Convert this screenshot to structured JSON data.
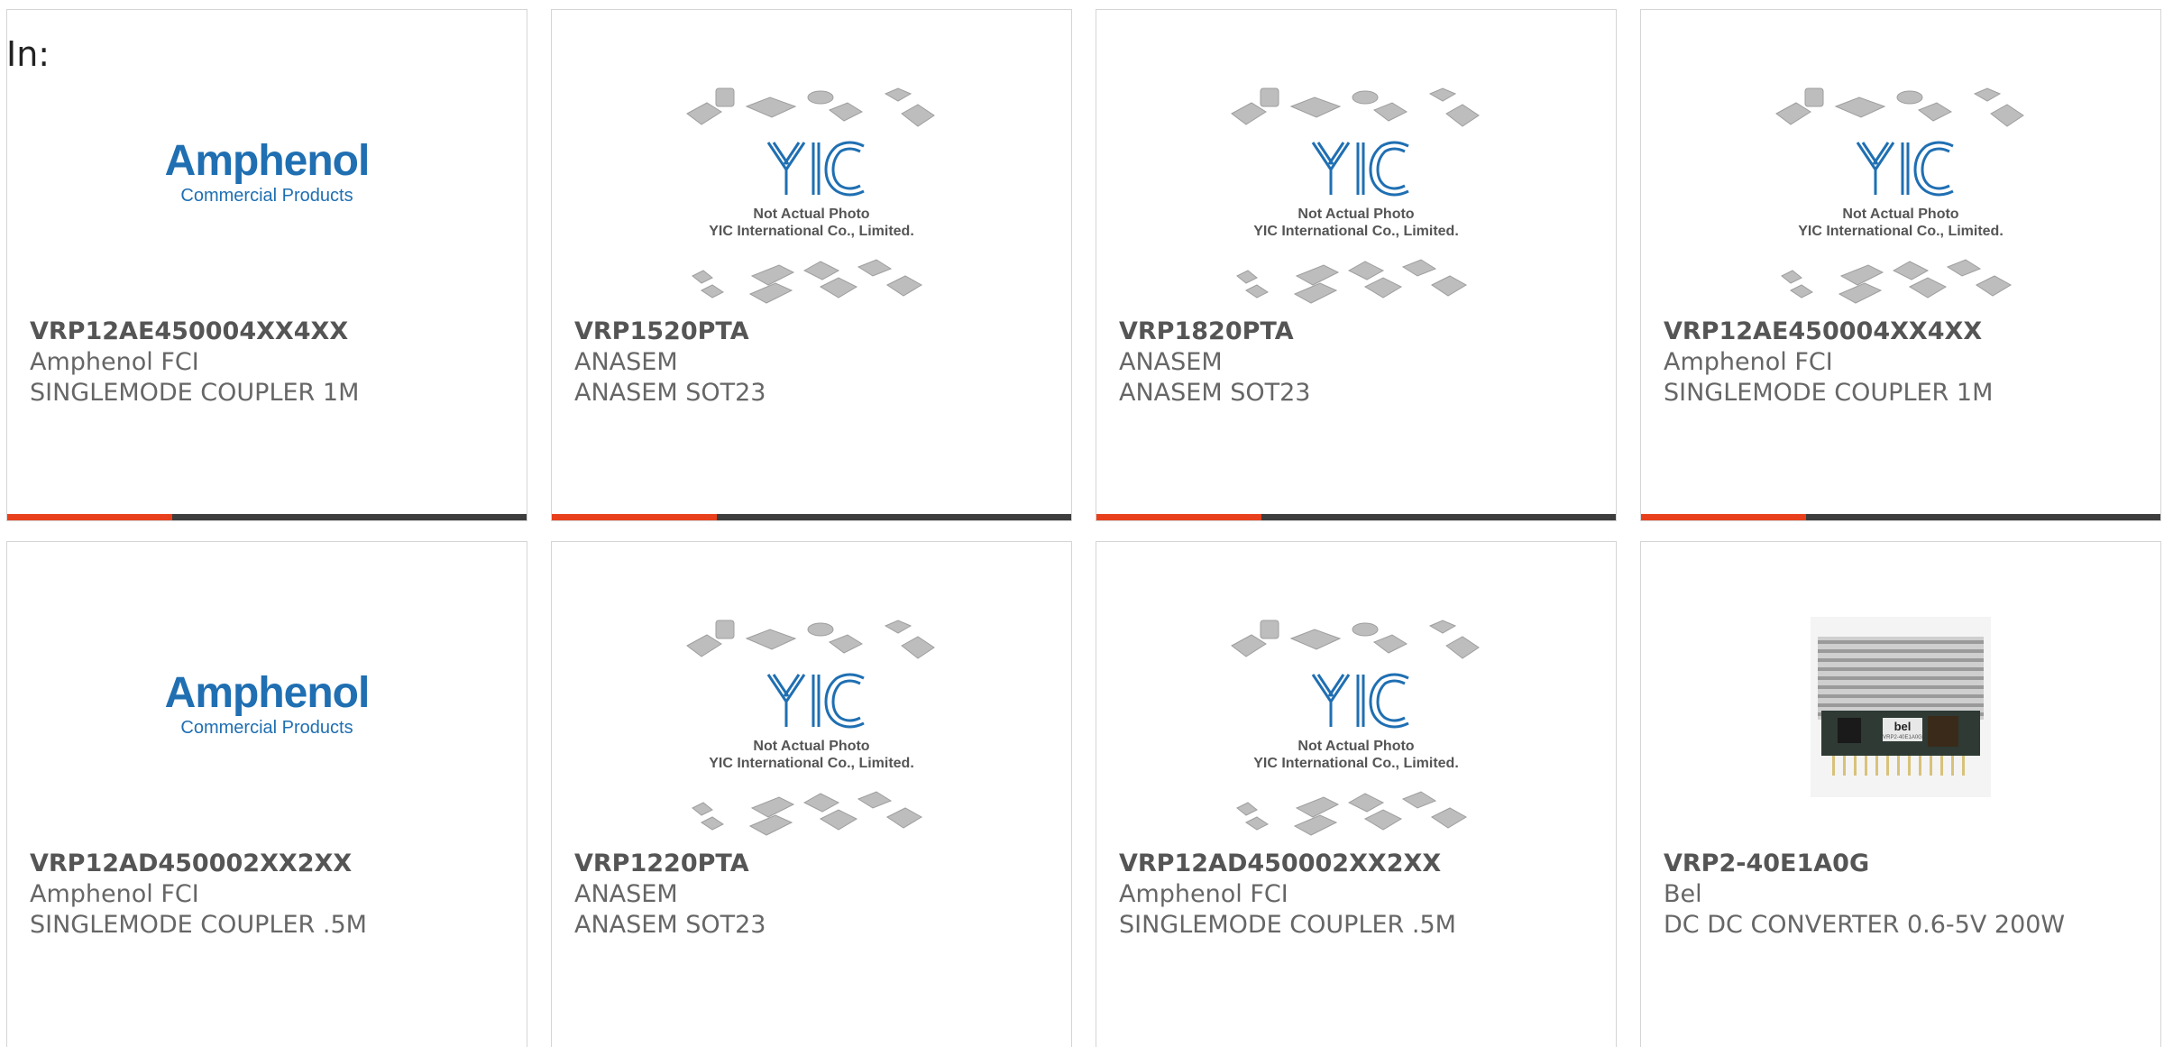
{
  "header": {
    "in_label": "In:"
  },
  "placeholder": {
    "line1": "Not Actual Photo",
    "line2": "YIC International Co., Limited.",
    "logo_text": "YIC"
  },
  "logos": {
    "amphenol_brand": "Amphenol",
    "amphenol_sub": "Commercial Products",
    "bel_label": "bel",
    "bel_model": "VRP2-40E1A0G"
  },
  "colors": {
    "accent": "#e8401c",
    "bar_dark": "#3d3d3d",
    "amphenol_blue": "#1f6fb2"
  },
  "products": [
    {
      "part": "VRP12AE450004XX4XX",
      "maker": "Amphenol FCI",
      "desc": "SINGLEMODE COUPLER 1M",
      "image": "amphenol-logo"
    },
    {
      "part": "VRP1520PTA",
      "maker": "ANASEM",
      "desc": "ANASEM SOT23",
      "image": "yic-placeholder"
    },
    {
      "part": "VRP1820PTA",
      "maker": "ANASEM",
      "desc": "ANASEM SOT23",
      "image": "yic-placeholder"
    },
    {
      "part": "VRP12AE450004XX4XX",
      "maker": "Amphenol FCI",
      "desc": "SINGLEMODE COUPLER 1M",
      "image": "amphenol-logo"
    },
    {
      "part": "VRP12AD450002XX2XX",
      "maker": "Amphenol FCI",
      "desc": "SINGLEMODE COUPLER .5M",
      "image": "amphenol-logo"
    },
    {
      "part": "VRP1220PTA",
      "maker": "ANASEM",
      "desc": "ANASEM SOT23",
      "image": "yic-placeholder"
    },
    {
      "part": "VRP12AD450002XX2XX",
      "maker": "Amphenol FCI",
      "desc": "SINGLEMODE COUPLER .5M",
      "image": "yic-placeholder"
    },
    {
      "part": "VRP2-40E1A0G",
      "maker": "Bel",
      "desc": "DC DC CONVERTER 0.6-5V 200W",
      "image": "bel-photo"
    }
  ]
}
